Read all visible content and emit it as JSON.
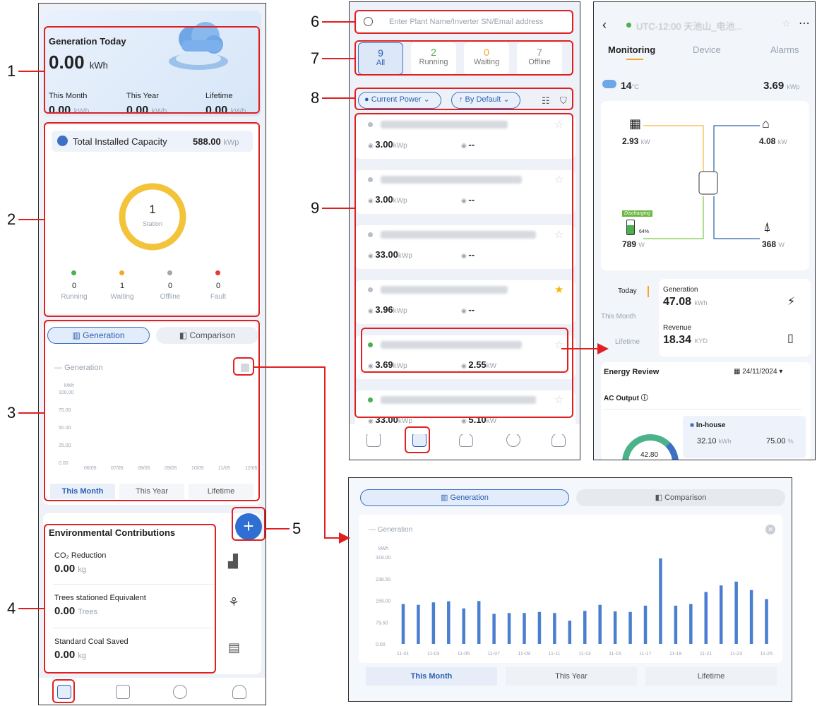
{
  "callouts": [
    "1",
    "2",
    "3",
    "4",
    "5",
    "6",
    "7",
    "8",
    "9"
  ],
  "home": {
    "gen_today_label": "Generation Today",
    "gen_today_value": "0.00",
    "gen_today_unit": "kWh",
    "this_month_label": "This Month",
    "this_year_label": "This Year",
    "lifetime_label": "Lifetime",
    "this_month_value": "0.00",
    "this_year_value": "0.00",
    "lifetime_value": "0.00",
    "kwh": "kWh",
    "capacity_label": "Total Installed Capacity",
    "capacity_value": "588.00",
    "capacity_unit": "kWp",
    "station_count": "1",
    "station_label": "Station",
    "statuses": [
      {
        "count": "0",
        "label": "Running",
        "color": "#4caf50"
      },
      {
        "count": "1",
        "label": "Waiting",
        "color": "#f5a623"
      },
      {
        "count": "0",
        "label": "Offline",
        "color": "#a0a6b0"
      },
      {
        "count": "0",
        "label": "Fault",
        "color": "#e53935"
      }
    ],
    "tab_generation": "Generation",
    "tab_comparison": "Comparison",
    "legend": "Generation",
    "y_unit": "kWh",
    "y_ticks": [
      "100.00",
      "75.00",
      "50.00",
      "25.00",
      "0.00"
    ],
    "x_ticks": [
      "06/05",
      "07/05",
      "08/05",
      "09/05",
      "10/05",
      "11/05",
      "12/05"
    ],
    "period_this_month": "This Month",
    "period_this_year": "This Year",
    "period_lifetime": "Lifetime",
    "env_title": "Environmental Contributions",
    "co2_label": "CO₂ Reduction",
    "co2_value": "0.00",
    "co2_unit": "kg",
    "trees_label": "Trees stationed Equivalent",
    "trees_value": "0.00",
    "trees_unit": "Trees",
    "coal_label": "Standard Coal Saved",
    "coal_value": "0.00",
    "coal_unit": "kg",
    "fab": "+"
  },
  "plants": {
    "search_placeholder": "Enter Plant Name/Inverter SN/Email address",
    "tabs": [
      {
        "count": "9",
        "label": "All",
        "color": "#2a5fb0"
      },
      {
        "count": "2",
        "label": "Running",
        "color": "#4caf50"
      },
      {
        "count": "0",
        "label": "Waiting",
        "color": "#f5a623"
      },
      {
        "count": "7",
        "label": "Offline",
        "color": "#8a93a0"
      }
    ],
    "filter_power": "Current Power",
    "filter_sort": "↑ By Default",
    "list": [
      {
        "cap": "3.00",
        "power": "--",
        "fav": false,
        "status": "#b8bec8"
      },
      {
        "cap": "3.00",
        "power": "--",
        "fav": false,
        "status": "#b8bec8"
      },
      {
        "cap": "33.00",
        "power": "--",
        "fav": false,
        "status": "#b8bec8"
      },
      {
        "cap": "3.96",
        "power": "--",
        "fav": true,
        "status": "#b8bec8"
      },
      {
        "cap": "3.69",
        "power": "2.55",
        "fav": false,
        "status": "#4caf50"
      },
      {
        "cap": "33.00",
        "power": "5.10",
        "fav": false,
        "status": "#4caf50"
      }
    ],
    "kwp": "kWp",
    "kw": "kW"
  },
  "detail": {
    "title": "UTC-12:00 天池山_电池...",
    "tabs": [
      "Monitoring",
      "Device",
      "Alarms"
    ],
    "temp": "14",
    "temp_unit": "°C",
    "capacity": "3.69",
    "capacity_unit": "kWp",
    "pv": "2.93",
    "pv_unit": "kW",
    "load": "4.08",
    "load_unit": "kW",
    "battery_tag": "Discharging",
    "battery_soc": "64%",
    "battery": "789",
    "battery_unit": "W",
    "grid": "368",
    "grid_unit": "W",
    "periods": [
      "Today",
      "This Month",
      "Lifetime"
    ],
    "gen_label": "Generation",
    "gen_value": "47.08",
    "gen_unit": "kWh",
    "rev_label": "Revenue",
    "rev_value": "18.34",
    "rev_unit": "KYD",
    "energy_review": "Energy Review",
    "date": "24/11/2024",
    "ac_output": "AC Output",
    "inhouse": "In-house",
    "inhouse_value": "32.10",
    "inhouse_unit": "kWh",
    "inhouse_pct": "75.00",
    "pct": "%",
    "donut_value": "42.80"
  },
  "zoom": {
    "tab_generation": "Generation",
    "tab_comparison": "Comparison",
    "legend": "Generation",
    "y_unit": "kWh",
    "period_this_month": "This Month",
    "period_this_year": "This Year",
    "period_lifetime": "Lifetime"
  },
  "chart_data": {
    "type": "bar",
    "legend": [
      "Generation"
    ],
    "ylabel": "kWh",
    "ylim": [
      0,
      318
    ],
    "y_ticks": [
      "318.00",
      "238.50",
      "159.00",
      "79.50",
      "0.00"
    ],
    "x_tick_labels": [
      "11-01",
      "11-03",
      "11-05",
      "11-07",
      "11-09",
      "11-11",
      "11-13",
      "11-15",
      "11-17",
      "11-19",
      "11-21",
      "11-23",
      "11-25"
    ],
    "categories": [
      "11-01",
      "11-02",
      "11-03",
      "11-04",
      "11-05",
      "11-06",
      "11-07",
      "11-08",
      "11-09",
      "11-10",
      "11-11",
      "11-12",
      "11-13",
      "11-14",
      "11-15",
      "11-16",
      "11-17",
      "11-18",
      "11-19",
      "11-20",
      "11-21",
      "11-22",
      "11-23",
      "11-24",
      "11-25"
    ],
    "values": [
      146,
      143,
      152,
      156,
      130,
      157,
      110,
      113,
      113,
      117,
      113,
      85,
      121,
      143,
      119,
      117,
      140,
      313,
      140,
      146,
      190,
      214,
      228,
      197,
      164
    ],
    "color": "#4a7fd0"
  }
}
